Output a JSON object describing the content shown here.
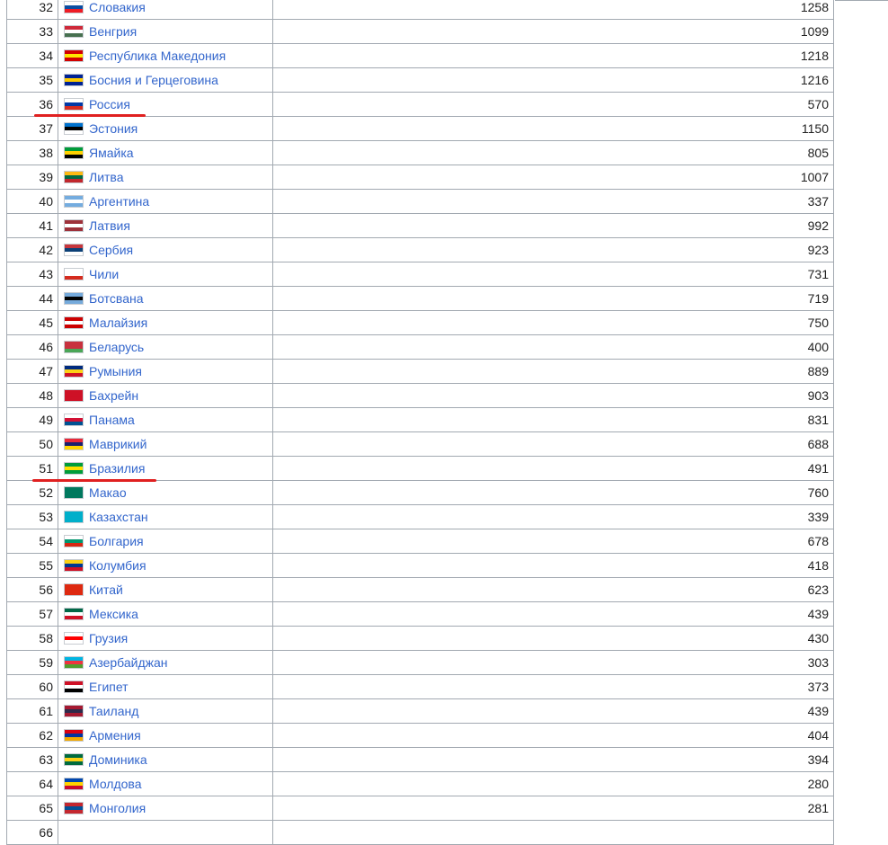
{
  "table": {
    "rows": [
      {
        "rank": "32",
        "country": "Словакия",
        "value": "1258",
        "flag": [
          "#ffffff",
          "#0b4ea2",
          "#ee1c25"
        ]
      },
      {
        "rank": "33",
        "country": "Венгрия",
        "value": "1099",
        "flag": [
          "#ce2939",
          "#ffffff",
          "#477050"
        ]
      },
      {
        "rank": "34",
        "country": "Республика Македония",
        "value": "1218",
        "flag": [
          "#d20000",
          "#ffe600",
          "#d20000"
        ]
      },
      {
        "rank": "35",
        "country": "Босния и Герцеговина",
        "value": "1216",
        "flag": [
          "#002395",
          "#fecb00",
          "#002395"
        ]
      },
      {
        "rank": "36",
        "country": "Россия",
        "value": "570",
        "flag": [
          "#ffffff",
          "#0039a6",
          "#d52b1e"
        ]
      },
      {
        "rank": "37",
        "country": "Эстония",
        "value": "1150",
        "flag": [
          "#0072ce",
          "#000000",
          "#ffffff"
        ]
      },
      {
        "rank": "38",
        "country": "Ямайка",
        "value": "805",
        "flag": [
          "#009b3a",
          "#fed100",
          "#000000"
        ]
      },
      {
        "rank": "39",
        "country": "Литва",
        "value": "1007",
        "flag": [
          "#fdb913",
          "#006a44",
          "#c1272d"
        ]
      },
      {
        "rank": "40",
        "country": "Аргентина",
        "value": "337",
        "flag": [
          "#74acdf",
          "#ffffff",
          "#74acdf"
        ]
      },
      {
        "rank": "41",
        "country": "Латвия",
        "value": "992",
        "flag": [
          "#9e3039",
          "#ffffff",
          "#9e3039"
        ]
      },
      {
        "rank": "42",
        "country": "Сербия",
        "value": "923",
        "flag": [
          "#c6363c",
          "#0c4076",
          "#ffffff"
        ]
      },
      {
        "rank": "43",
        "country": "Чили",
        "value": "731",
        "flag": [
          "#ffffff",
          "#ffffff",
          "#d52b1e"
        ]
      },
      {
        "rank": "44",
        "country": "Ботсвана",
        "value": "719",
        "flag": [
          "#75aadb",
          "#000000",
          "#75aadb"
        ]
      },
      {
        "rank": "45",
        "country": "Малайзия",
        "value": "750",
        "flag": [
          "#cc0001",
          "#ffffff",
          "#cc0001"
        ]
      },
      {
        "rank": "46",
        "country": "Беларусь",
        "value": "400",
        "flag": [
          "#c8313e",
          "#c8313e",
          "#4aa657"
        ]
      },
      {
        "rank": "47",
        "country": "Румыния",
        "value": "889",
        "flag": [
          "#002b7f",
          "#fcd116",
          "#ce1126"
        ]
      },
      {
        "rank": "48",
        "country": "Бахрейн",
        "value": "903",
        "flag": [
          "#ce1126",
          "#ce1126",
          "#ce1126"
        ]
      },
      {
        "rank": "49",
        "country": "Панама",
        "value": "831",
        "flag": [
          "#ffffff",
          "#d21034",
          "#005293"
        ]
      },
      {
        "rank": "50",
        "country": "Маврикий",
        "value": "688",
        "flag": [
          "#ea2839",
          "#1a206d",
          "#ffd500"
        ]
      },
      {
        "rank": "51",
        "country": "Бразилия",
        "value": "491",
        "flag": [
          "#009c3b",
          "#ffdf00",
          "#009c3b"
        ]
      },
      {
        "rank": "52",
        "country": "Макао",
        "value": "760",
        "flag": [
          "#00785e",
          "#00785e",
          "#00785e"
        ]
      },
      {
        "rank": "53",
        "country": "Казахстан",
        "value": "339",
        "flag": [
          "#00afca",
          "#00afca",
          "#00afca"
        ]
      },
      {
        "rank": "54",
        "country": "Болгария",
        "value": "678",
        "flag": [
          "#ffffff",
          "#00966e",
          "#d62612"
        ]
      },
      {
        "rank": "55",
        "country": "Колумбия",
        "value": "418",
        "flag": [
          "#fcd116",
          "#003893",
          "#ce1126"
        ]
      },
      {
        "rank": "56",
        "country": "Китай",
        "value": "623",
        "flag": [
          "#de2910",
          "#de2910",
          "#de2910"
        ]
      },
      {
        "rank": "57",
        "country": "Мексика",
        "value": "439",
        "flag": [
          "#006847",
          "#ffffff",
          "#ce1126"
        ]
      },
      {
        "rank": "58",
        "country": "Грузия",
        "value": "430",
        "flag": [
          "#ffffff",
          "#ff0000",
          "#ffffff"
        ]
      },
      {
        "rank": "59",
        "country": "Азербайджан",
        "value": "303",
        "flag": [
          "#00b5e2",
          "#ef3340",
          "#509e2f"
        ]
      },
      {
        "rank": "60",
        "country": "Египет",
        "value": "373",
        "flag": [
          "#ce1126",
          "#ffffff",
          "#000000"
        ]
      },
      {
        "rank": "61",
        "country": "Таиланд",
        "value": "439",
        "flag": [
          "#a51931",
          "#2d2a4a",
          "#a51931"
        ]
      },
      {
        "rank": "62",
        "country": "Армения",
        "value": "404",
        "flag": [
          "#d90012",
          "#0033a0",
          "#f2a800"
        ]
      },
      {
        "rank": "63",
        "country": "Доминика",
        "value": "394",
        "flag": [
          "#006b3f",
          "#fcd116",
          "#006b3f"
        ]
      },
      {
        "rank": "64",
        "country": "Молдова",
        "value": "280",
        "flag": [
          "#0046ae",
          "#ffd200",
          "#cc092f"
        ]
      },
      {
        "rank": "65",
        "country": "Монголия",
        "value": "281",
        "flag": [
          "#c4272f",
          "#015197",
          "#c4272f"
        ]
      },
      {
        "rank": "66",
        "country": "",
        "value": "",
        "flag": [
          "#ffffff",
          "#ffffff",
          "#ffffff"
        ]
      }
    ]
  },
  "colors": {
    "link": "#3366cc",
    "border": "#a2a9b1",
    "text": "#222222",
    "annotation": "#e02020"
  }
}
